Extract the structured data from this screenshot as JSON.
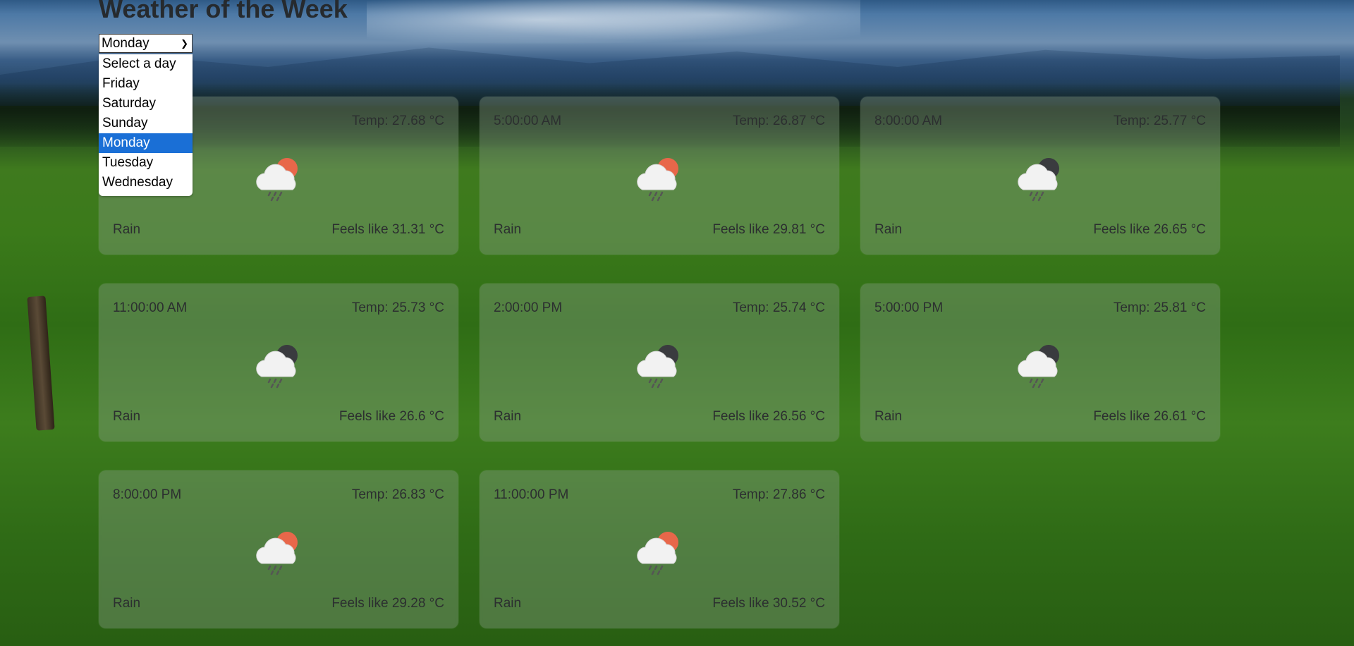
{
  "page": {
    "title": "Weather of the Week"
  },
  "day_select": {
    "selected": "Monday",
    "options": [
      "Select a day",
      "Friday",
      "Saturday",
      "Sunday",
      "Monday",
      "Tuesday",
      "Wednesday"
    ]
  },
  "cards": [
    {
      "time": "",
      "temp": "Temp: 27.68 °C",
      "condition": "Rain",
      "feels": "Feels like 31.31 °C",
      "icon": "rain-day-icon"
    },
    {
      "time": "5:00:00 AM",
      "temp": "Temp: 26.87 °C",
      "condition": "Rain",
      "feels": "Feels like 29.81 °C",
      "icon": "rain-day-icon"
    },
    {
      "time": "8:00:00 AM",
      "temp": "Temp: 25.77 °C",
      "condition": "Rain",
      "feels": "Feels like 26.65 °C",
      "icon": "rain-night-icon"
    },
    {
      "time": "11:00:00 AM",
      "temp": "Temp: 25.73 °C",
      "condition": "Rain",
      "feels": "Feels like 26.6 °C",
      "icon": "rain-night-icon"
    },
    {
      "time": "2:00:00 PM",
      "temp": "Temp: 25.74 °C",
      "condition": "Rain",
      "feels": "Feels like 26.56 °C",
      "icon": "rain-night-icon"
    },
    {
      "time": "5:00:00 PM",
      "temp": "Temp: 25.81 °C",
      "condition": "Rain",
      "feels": "Feels like 26.61 °C",
      "icon": "rain-night-icon"
    },
    {
      "time": "8:00:00 PM",
      "temp": "Temp: 26.83 °C",
      "condition": "Rain",
      "feels": "Feels like 29.28 °C",
      "icon": "rain-day-icon"
    },
    {
      "time": "11:00:00 PM",
      "temp": "Temp: 27.86 °C",
      "condition": "Rain",
      "feels": "Feels like 30.52 °C",
      "icon": "rain-day-icon"
    }
  ],
  "colors": {
    "sun": "#e8674a",
    "moon": "#3a3b3f",
    "selected_option": "#1a6fd6"
  }
}
